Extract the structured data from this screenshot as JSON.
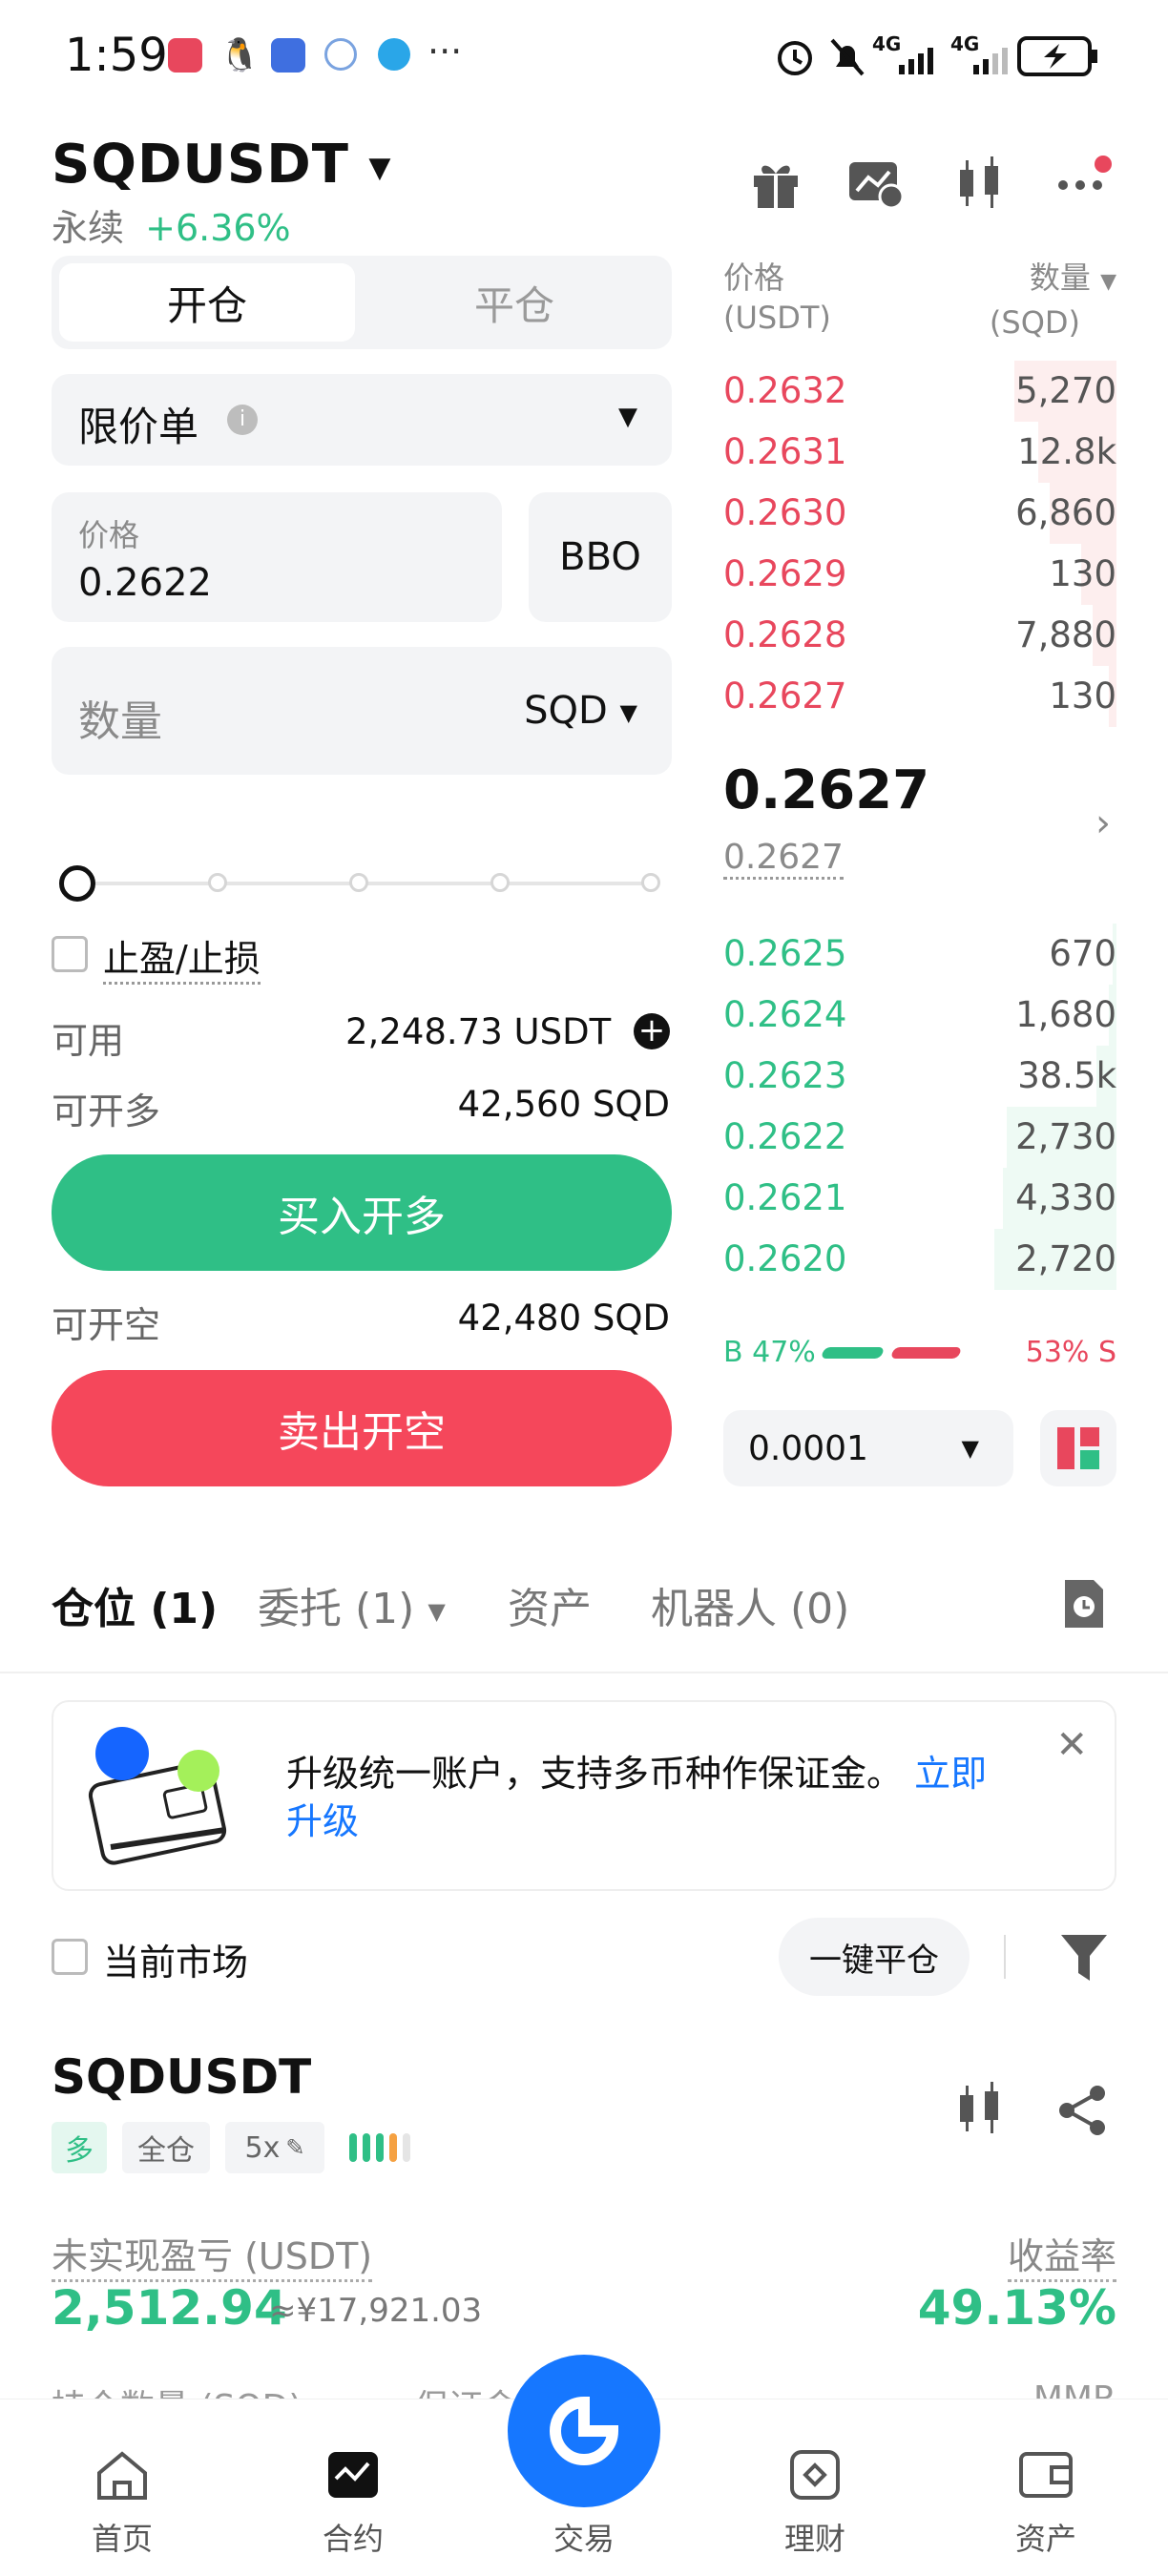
{
  "status_bar": {
    "time": "1:59",
    "more": "···",
    "net1": "4G",
    "net2": "4G"
  },
  "header": {
    "symbol": "SQDUSDT",
    "contract_type": "永续",
    "change": "+6.36%"
  },
  "order_form": {
    "tab_open": "开仓",
    "tab_close": "平仓",
    "order_type": "限价单",
    "price_label": "价格",
    "price_value": "0.2622",
    "bbo": "BBO",
    "qty_placeholder": "数量",
    "qty_unit": "SQD",
    "tp_sl": "止盈/止损",
    "available_label": "可用",
    "available_value": "2,248.73 USDT",
    "can_long_label": "可开多",
    "can_long_value": "42,560 SQD",
    "buy_button": "买入开多",
    "can_short_label": "可开空",
    "can_short_value": "42,480 SQD",
    "sell_button": "卖出开空",
    "slider_percent": 0
  },
  "order_book": {
    "price_header": "价格",
    "price_unit": "(USDT)",
    "qty_header": "数量",
    "qty_unit": "(SQD)",
    "asks": [
      {
        "price": "0.2632",
        "qty": "5,270",
        "depth": 0.26
      },
      {
        "price": "0.2631",
        "qty": "12.8k",
        "depth": 0.2
      },
      {
        "price": "0.2630",
        "qty": "6,860",
        "depth": 0.17
      },
      {
        "price": "0.2629",
        "qty": "130",
        "depth": 0.09
      },
      {
        "price": "0.2628",
        "qty": "7,880",
        "depth": 0.06
      },
      {
        "price": "0.2627",
        "qty": "130",
        "depth": 0.02
      }
    ],
    "last_price": "0.2627",
    "mark_price": "0.2627",
    "bids": [
      {
        "price": "0.2625",
        "qty": "670",
        "depth": 0.01
      },
      {
        "price": "0.2624",
        "qty": "1,680",
        "depth": 0.02
      },
      {
        "price": "0.2623",
        "qty": "38.5k",
        "depth": 0.05
      },
      {
        "price": "0.2622",
        "qty": "2,730",
        "depth": 0.28
      },
      {
        "price": "0.2621",
        "qty": "4,330",
        "depth": 0.29
      },
      {
        "price": "0.2620",
        "qty": "2,720",
        "depth": 0.31
      }
    ],
    "buy_ratio_label": "B 47%",
    "sell_ratio_label": "53% S",
    "buy_ratio": 0.47,
    "precision": "0.0001"
  },
  "positions_tabs": {
    "positions": "仓位 (1)",
    "orders": "委托 (1)",
    "assets": "资产",
    "bots": "机器人 (0)"
  },
  "banner": {
    "text": "升级统一账户，支持多币种作保证金。",
    "link_1": "立即",
    "link_2": "升级"
  },
  "filter": {
    "current_market": "当前市场",
    "close_all": "一键平仓"
  },
  "position": {
    "symbol": "SQDUSDT",
    "side": "多",
    "margin_mode": "全仓",
    "leverage": "5x",
    "pnl_label": "未实现盈亏 (USDT)",
    "pnl_value": "2,512.94",
    "pnl_cny": "≈¥17,921.03",
    "roe_label": "收益率",
    "roe_value": "49.13%",
    "size_label": "持仓数量 (SQD)",
    "margin_label": "保证金",
    "mmr_label": "MMR"
  },
  "bottom_nav": {
    "home": "首页",
    "futures": "合约",
    "trade": "交易",
    "earn": "理财",
    "assets": "资产"
  },
  "colors": {
    "green": "#2fbf86",
    "red": "#e8475d",
    "blue": "#1677ff"
  }
}
